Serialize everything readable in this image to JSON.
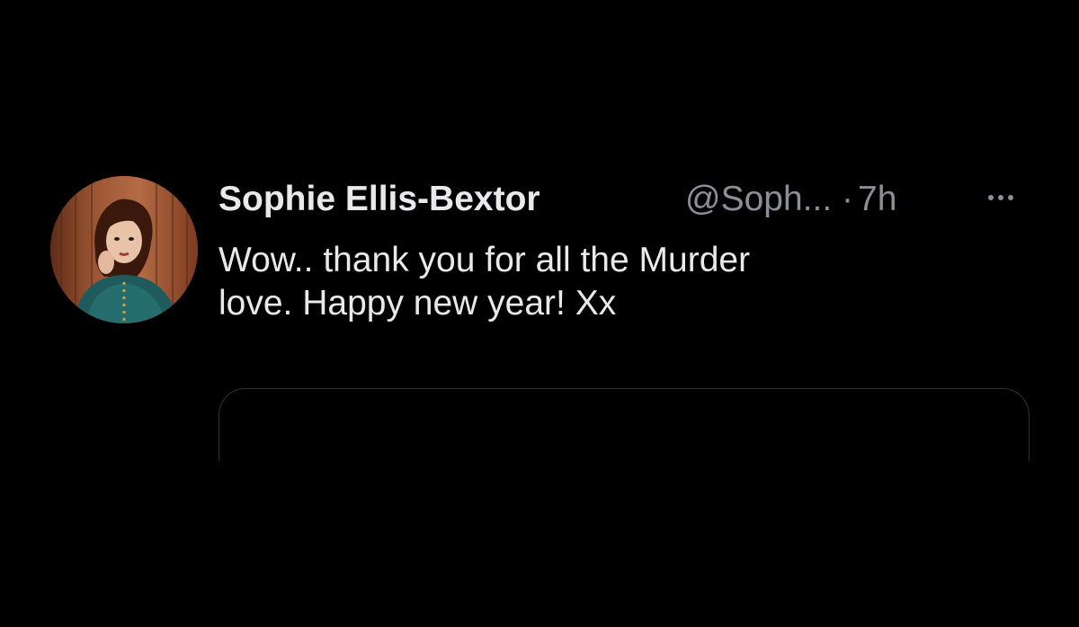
{
  "tweet": {
    "display_name": "Sophie Ellis-Bextor",
    "handle": "@Soph...",
    "separator": "·",
    "time": "7h",
    "text": "Wow.. thank you for all the Murder\nlove. Happy new year! Xx",
    "avatar_icon": "profile-photo-icon",
    "more_icon": "more-horizontal-icon"
  },
  "colors": {
    "background": "#000000",
    "primary_text": "#e7e9ea",
    "secondary_text": "#8b9096",
    "border": "#2f3336"
  }
}
